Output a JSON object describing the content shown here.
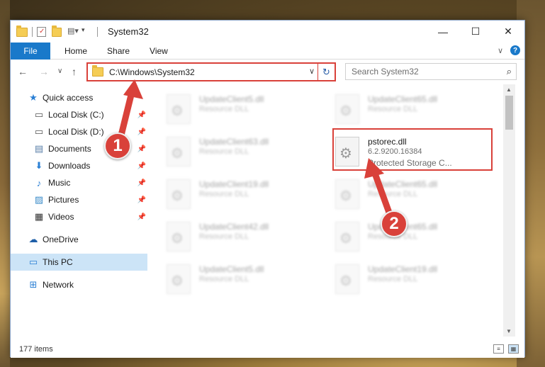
{
  "window": {
    "title": "System32",
    "controls": {
      "minimize": "—",
      "maximize": "☐",
      "close": "✕"
    }
  },
  "ribbon": {
    "file_tab": "File",
    "tabs": [
      "Home",
      "Share",
      "View"
    ],
    "expand_icon": "∨",
    "help_icon": "?"
  },
  "nav": {
    "back": "←",
    "forward": "→",
    "recent": "∨",
    "up": "↑",
    "address": "C:\\Windows\\System32",
    "address_chevron": "∨",
    "refresh": "↻",
    "search_placeholder": "Search System32",
    "search_icon": "⌕"
  },
  "sidebar": {
    "items": [
      {
        "label": "Quick access",
        "icon": "★",
        "pin": ""
      },
      {
        "label": "Local Disk (C:)",
        "icon": "▭",
        "pin": "📌"
      },
      {
        "label": "Local Disk (D:)",
        "icon": "▭",
        "pin": "📌"
      },
      {
        "label": "Documents",
        "icon": "▤",
        "pin": "📌"
      },
      {
        "label": "Downloads",
        "icon": "⬇",
        "pin": "📌"
      },
      {
        "label": "Music",
        "icon": "♪",
        "pin": "📌"
      },
      {
        "label": "Pictures",
        "icon": "▨",
        "pin": "📌"
      },
      {
        "label": "Videos",
        "icon": "▦",
        "pin": "📌"
      },
      {
        "label": "OneDrive",
        "icon": "☁",
        "pin": ""
      },
      {
        "label": "This PC",
        "icon": "▭",
        "pin": ""
      },
      {
        "label": "Network",
        "icon": "⊞",
        "pin": ""
      }
    ]
  },
  "files": [
    {
      "name": "UpdateClient5.dll",
      "type": "Resource DLL"
    },
    {
      "name": "UpdateClient65.dll",
      "type": "Resource DLL"
    },
    {
      "name": "UpdateClient63.dll",
      "type": "Resource DLL"
    },
    {
      "name": "pstorec.dll",
      "version": "6.2.9200.16384",
      "description": "Protected Storage C..."
    },
    {
      "name": "UpdateClient19.dll",
      "type": "Resource DLL"
    },
    {
      "name": "UpdateClient65.dll",
      "type": "Resource DLL"
    },
    {
      "name": "UpdateClient42.dll",
      "type": "Resource DLL"
    },
    {
      "name": "UpdateClient65.dll",
      "type": "Resource DLL"
    },
    {
      "name": "UpdateClient5.dll",
      "type": "Resource DLL"
    },
    {
      "name": "UpdateClient19.dll",
      "type": "Resource DLL"
    }
  ],
  "status": {
    "item_count": "177 items"
  },
  "annotations": {
    "step1": "1",
    "step2": "2"
  },
  "colors": {
    "accent": "#1979ca",
    "highlight": "#d9413a",
    "selected": "#cce4f7"
  }
}
